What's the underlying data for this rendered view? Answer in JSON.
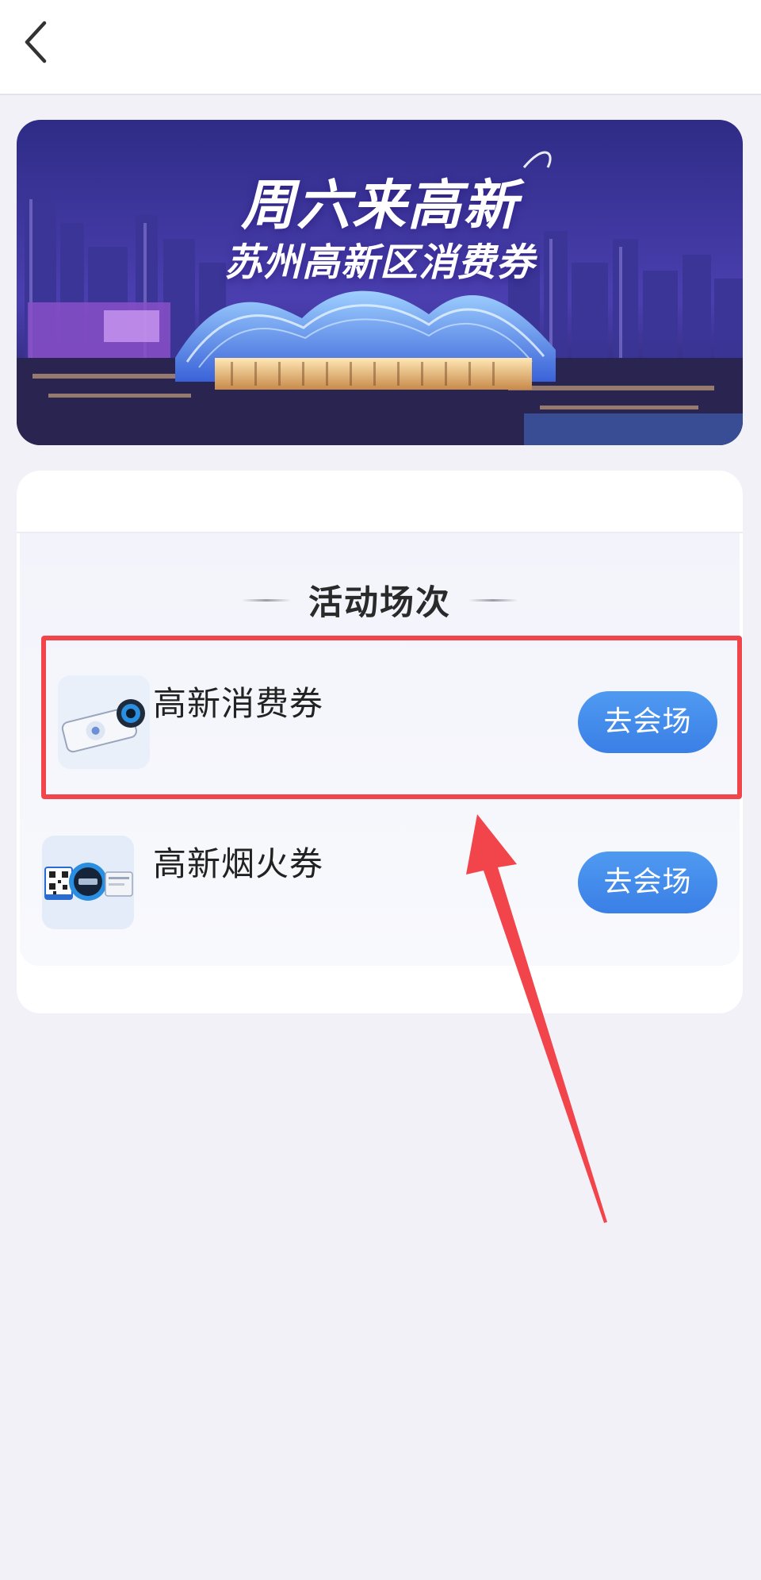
{
  "header": {
    "back_icon": "chevron-left-icon"
  },
  "banner": {
    "title_line1": "周六来高新",
    "title_line2": "苏州高新区消费券"
  },
  "activity": {
    "section_title": "活动场次",
    "events": [
      {
        "name": "高新消费券",
        "button_label": "去会场",
        "thumbnail": "voucher-device-image"
      },
      {
        "name": "高新烟火券",
        "button_label": "去会场",
        "thumbnail": "qr-code-kiosk-image"
      }
    ]
  },
  "annotations": {
    "highlight_color": "#f2454b",
    "arrow_color": "#f2454b"
  },
  "colors": {
    "background": "#f2f1f8",
    "button_blue": "#3f86ea"
  }
}
